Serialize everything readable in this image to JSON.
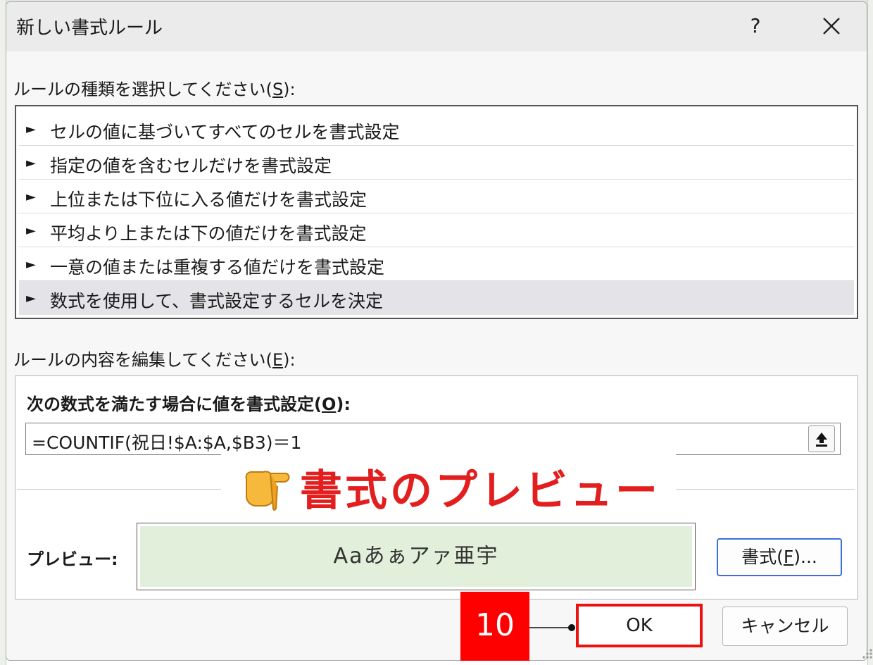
{
  "dialog": {
    "title": "新しい書式ルール",
    "help_label": "?",
    "rule_type_label": {
      "text": "ルールの種類を選択してください(",
      "key": "S",
      "suffix": "):"
    },
    "rule_types": [
      {
        "label": "セルの値に基づいてすべてのセルを書式設定",
        "selected": false
      },
      {
        "label": "指定の値を含むセルだけを書式設定",
        "selected": false
      },
      {
        "label": "上位または下位に入る値だけを書式設定",
        "selected": false
      },
      {
        "label": "平均より上または下の値だけを書式設定",
        "selected": false
      },
      {
        "label": "一意の値または重複する値だけを書式設定",
        "selected": false
      },
      {
        "label": "数式を使用して、書式設定するセルを決定",
        "selected": true
      }
    ],
    "rule_edit_label": {
      "text": "ルールの内容を編集してください(",
      "key": "E",
      "suffix": "):"
    },
    "formula_label": {
      "text": "次の数式を満たす場合に値を書式設定(",
      "key": "O",
      "suffix": "):"
    },
    "formula_value": "=COUNTIF(祝日!$A:$A,$B3)＝1",
    "preview_label": "プレビュー:",
    "preview_sample": "Aaあぁアァ亜宇",
    "format_button": {
      "text": "書式(",
      "key": "F",
      "suffix": ")..."
    },
    "ok_label": "OK",
    "cancel_label": "キャンセル"
  },
  "annotations": {
    "callout_text": "書式のプレビュー",
    "step_number": "10"
  },
  "colors": {
    "preview_fill": "#e2efda",
    "callout_red": "#e31e1e",
    "highlight_red": "#ee1111",
    "selected_row": "#e4e4e8"
  }
}
